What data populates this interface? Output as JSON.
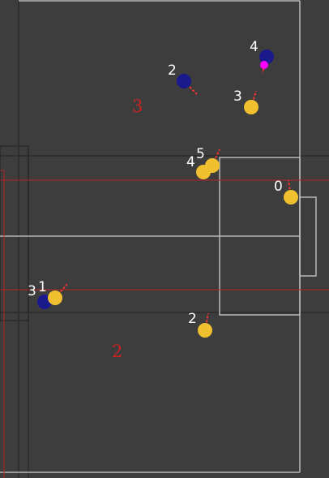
{
  "colors": {
    "background": "#3d3d3d",
    "pitch_line": "#b8b8b8",
    "grid_line": "#2b2b2b",
    "offside_line": "#b22222",
    "zone_label": "#cc2222",
    "team_blue": "#1a1a8c",
    "team_yellow": "#f0c030",
    "heading": "#ee3333",
    "ball": "#ff00ff",
    "player_label": "#ffffff"
  },
  "zones": [
    {
      "id": "zone-3",
      "label": "3"
    },
    {
      "id": "zone-2",
      "label": "2"
    }
  ],
  "players": [
    {
      "id": "blue-4",
      "team": "blue",
      "number": "4",
      "has_ball": true
    },
    {
      "id": "blue-2",
      "team": "blue",
      "number": "2",
      "has_ball": false
    },
    {
      "id": "yellow-3-top",
      "team": "yellow",
      "number": "3",
      "has_ball": false
    },
    {
      "id": "yellow-4",
      "team": "yellow",
      "number": "4",
      "has_ball": false
    },
    {
      "id": "yellow-5",
      "team": "yellow",
      "number": "5",
      "has_ball": false
    },
    {
      "id": "yellow-0",
      "team": "yellow",
      "number": "0",
      "has_ball": false
    },
    {
      "id": "blue-3",
      "team": "blue",
      "number": "3",
      "has_ball": false
    },
    {
      "id": "yellow-1",
      "team": "yellow",
      "number": "1",
      "has_ball": false
    },
    {
      "id": "yellow-2",
      "team": "yellow",
      "number": "2",
      "has_ball": false
    }
  ]
}
